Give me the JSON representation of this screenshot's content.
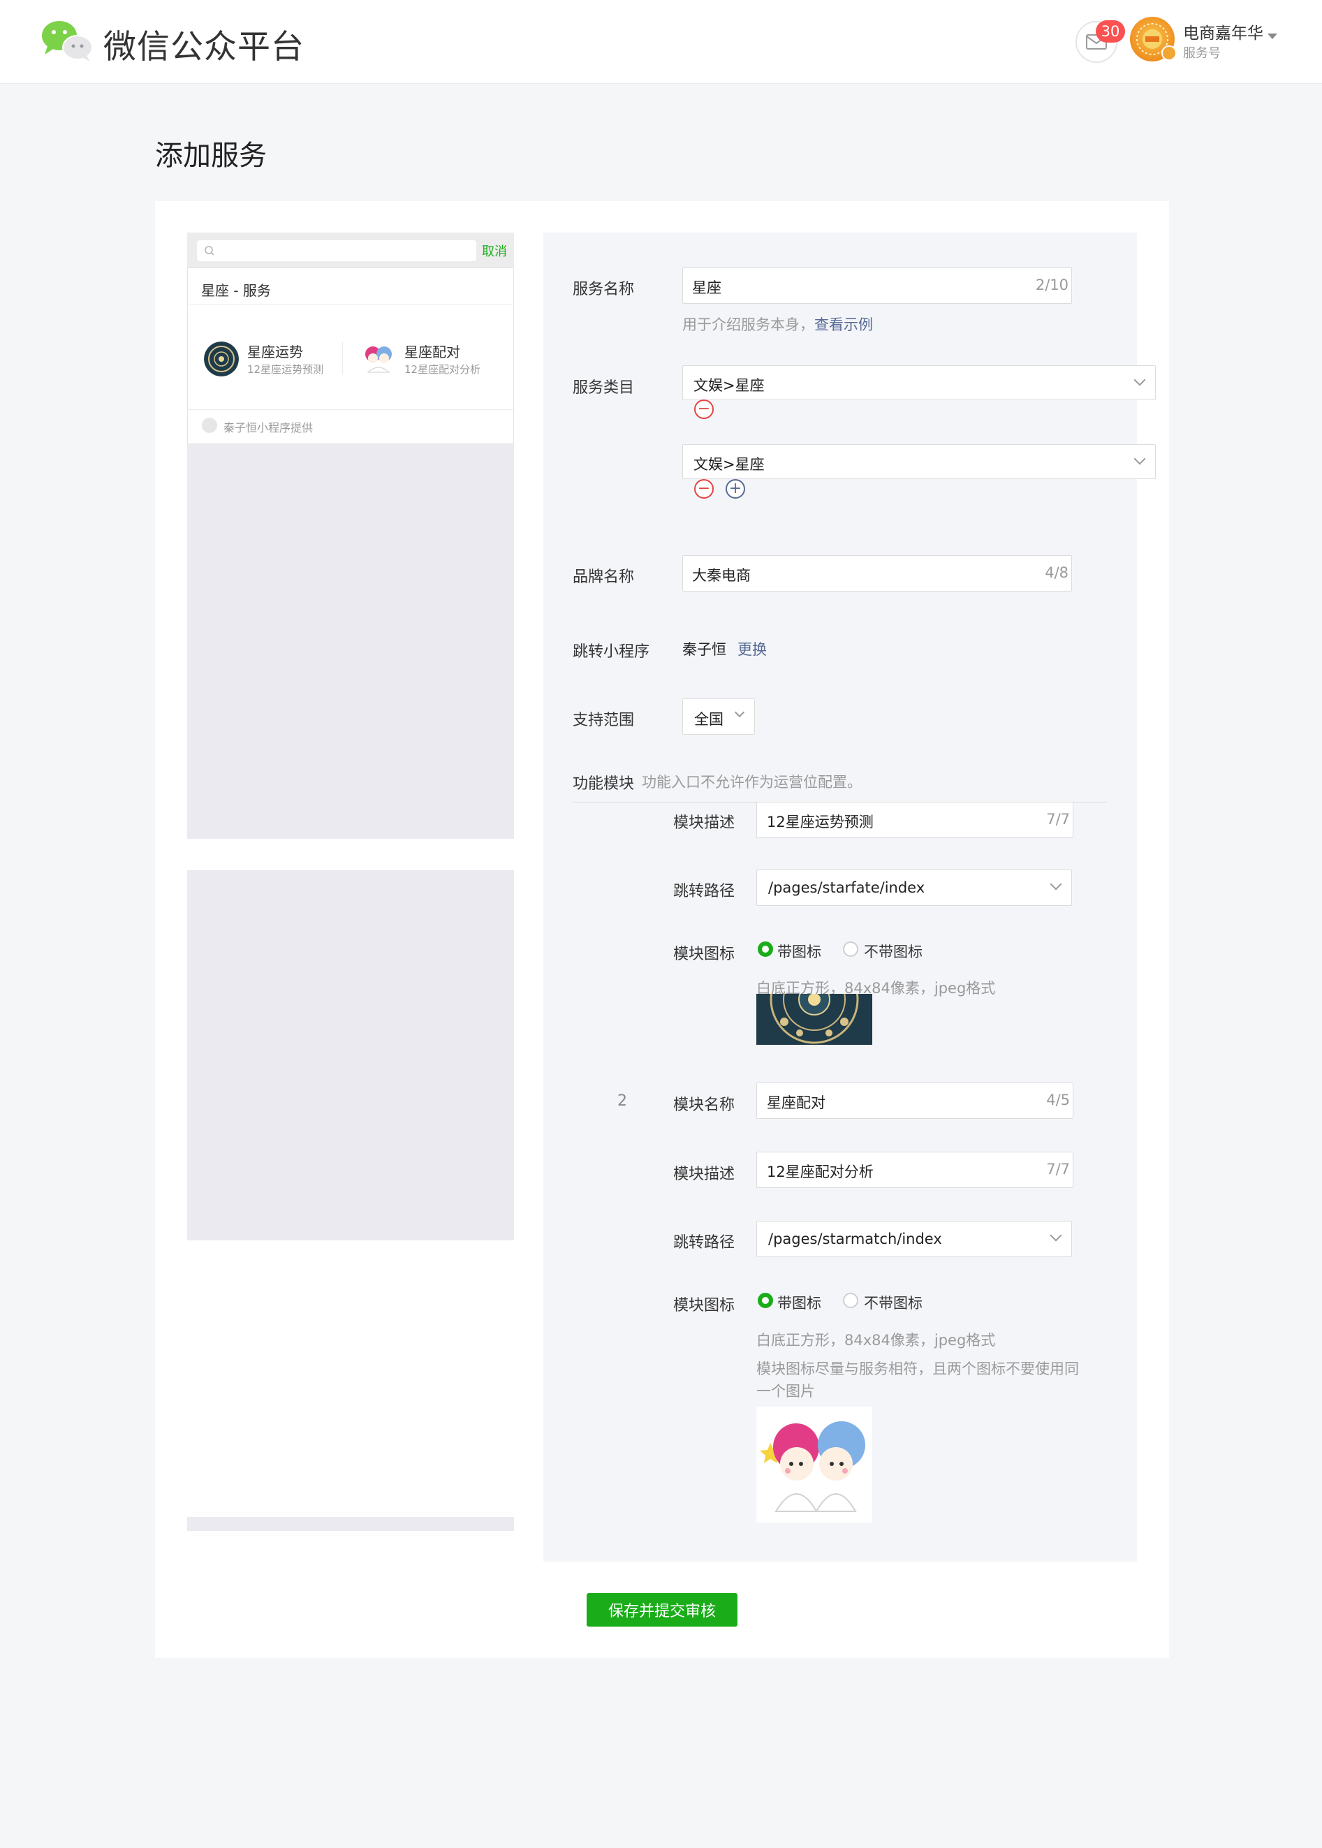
{
  "header": {
    "brand": "微信公众平台",
    "mail_badge": "30",
    "account_name": "电商嘉年华",
    "account_type": "服务号"
  },
  "page": {
    "title": "添加服务"
  },
  "preview": {
    "search_cancel": "取消",
    "service_heading": "星座 - 服务",
    "modules": [
      {
        "name": "星座运势",
        "desc": "12星座运势预测"
      },
      {
        "name": "星座配对",
        "desc": "12星座配对分析"
      }
    ],
    "provider": "秦子恒小程序提供"
  },
  "form": {
    "service_name": {
      "label": "服务名称",
      "value": "星座",
      "counter": "2/10",
      "hint": "用于介绍服务本身，",
      "hint_link": "查看示例"
    },
    "category": {
      "label": "服务类目",
      "selects": [
        "文娱>星座",
        "文娱>星座"
      ]
    },
    "brand": {
      "label": "品牌名称",
      "value": "大秦电商",
      "counter": "4/8"
    },
    "miniprogram": {
      "label": "跳转小程序",
      "value": "秦子恒",
      "action": "更换"
    },
    "scope": {
      "label": "支持范围",
      "value": "全国"
    },
    "modules_section": {
      "label": "功能模块",
      "note": "功能入口不允许作为运营位配置。"
    },
    "module1": {
      "desc_label": "模块描述",
      "desc_value": "12星座运势预测",
      "desc_counter": "7/7",
      "path_label": "跳转路径",
      "path_value": "/pages/starfate/index",
      "icon_label": "模块图标",
      "icon_yes": "带图标",
      "icon_no": "不带图标",
      "icon_hint": "白底正方形，84x84像素，jpeg格式"
    },
    "module2": {
      "index": "2",
      "name_label": "模块名称",
      "name_value": "星座配对",
      "name_counter": "4/5",
      "desc_label": "模块描述",
      "desc_value": "12星座配对分析",
      "desc_counter": "7/7",
      "path_label": "跳转路径",
      "path_value": "/pages/starmatch/index",
      "icon_label": "模块图标",
      "icon_yes": "带图标",
      "icon_no": "不带图标",
      "icon_hint": "白底正方形，84x84像素，jpeg格式",
      "icon_hint2_line1": "模块图标尽量与服务相符，且两个图标不要使用同",
      "icon_hint2_line2": "一个图片"
    }
  },
  "actions": {
    "submit": "保存并提交审核"
  },
  "colors": {
    "accent": "#1aad19",
    "link": "#576b95",
    "danger": "#e64340",
    "badge": "#fa5151"
  }
}
